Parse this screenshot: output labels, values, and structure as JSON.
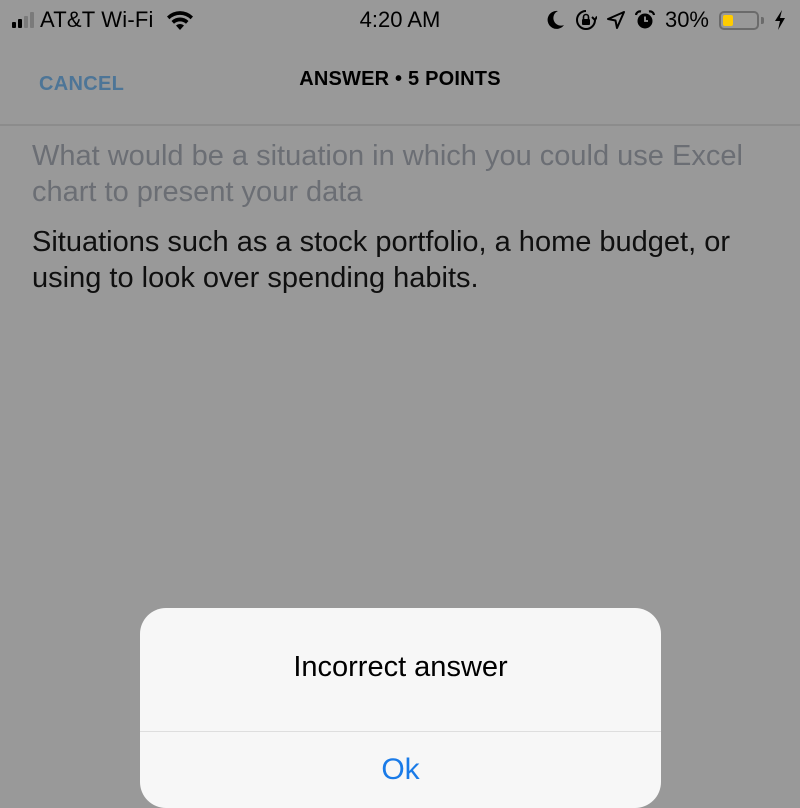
{
  "status_bar": {
    "carrier": "AT&T Wi-Fi",
    "signal_bars_active": 2,
    "signal_bars_total": 4,
    "time": "4:20 AM",
    "icons": [
      "moon-icon",
      "orientation-lock-icon",
      "location-arrow-icon",
      "alarm-icon"
    ],
    "battery_percent_label": "30%",
    "battery_level": 0.3,
    "battery_color": "#ffcc00",
    "charging": true
  },
  "nav": {
    "cancel_label": "CANCEL",
    "title": "ANSWER • 5 POINTS",
    "cancel_color": "#4d7597"
  },
  "content": {
    "question": "What would be a situation in which you could use Excel chart to present your data",
    "answer": "Situations such as a stock portfolio, a home budget, or using to look over spending habits."
  },
  "alert": {
    "title": "Incorrect answer",
    "ok_label": "Ok",
    "ok_color": "#1a7be8"
  }
}
